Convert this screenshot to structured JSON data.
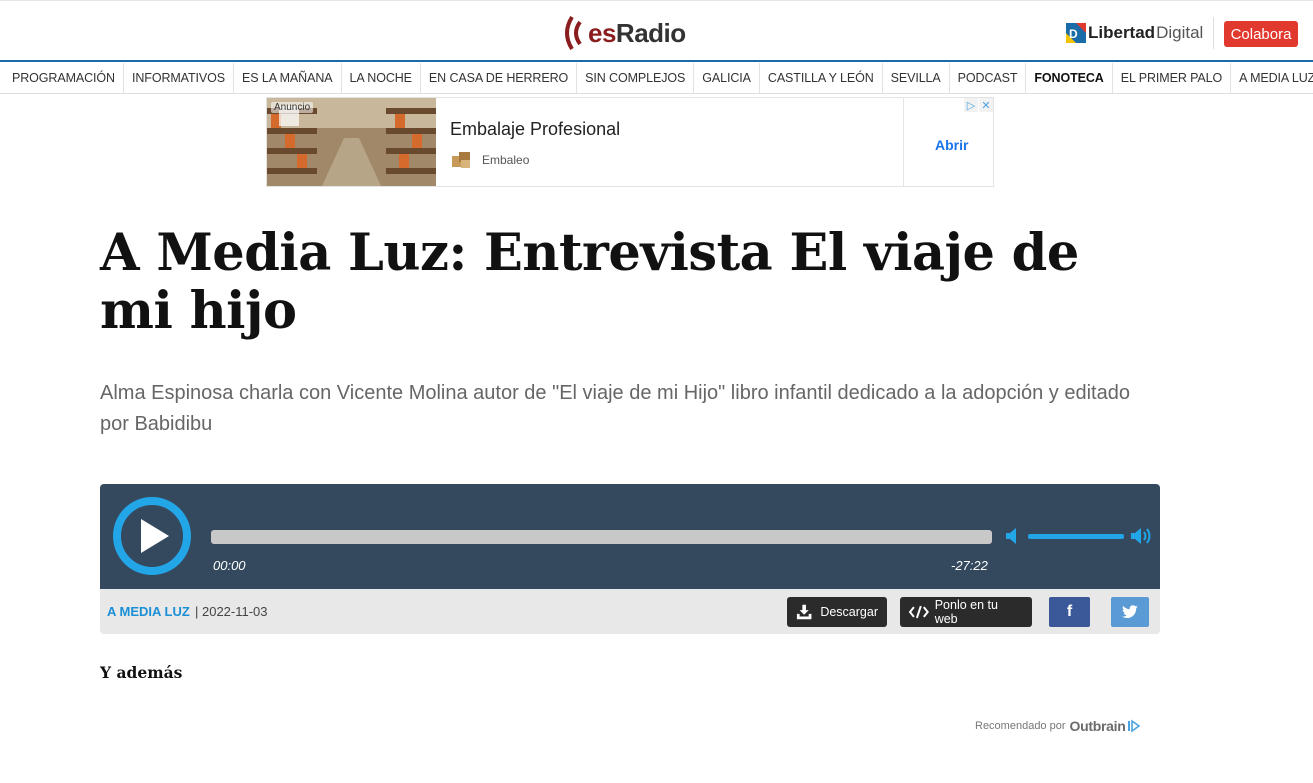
{
  "header": {
    "logo_prefix": "es",
    "logo_suffix": "Radio",
    "partner_bold": "Libertad",
    "partner_light": "Digital",
    "cta_label": "Colabora"
  },
  "nav": {
    "items": [
      "PROGRAMACIÓN",
      "INFORMATIVOS",
      "ES LA MAÑANA",
      "LA NOCHE",
      "EN CASA DE HERRERO",
      "SIN COMPLEJOS",
      "GALICIA",
      "CASTILLA Y LEÓN",
      "SEVILLA",
      "PODCAST",
      "FONOTECA",
      "EL PRIMER PALO",
      "A MEDIA LUZ"
    ],
    "active": "FONOTECA"
  },
  "ad": {
    "label": "Anuncio",
    "title": "Embalaje Profesional",
    "brand": "Embaleo",
    "cta": "Abrir"
  },
  "article": {
    "title": "A Media Luz: Entrevista El viaje de mi hijo",
    "subtitle": "Alma Espinosa charla con Vicente Molina autor de \"El viaje de mi Hijo\" libro infantil dedicado a la adopción y editado por Babidibu"
  },
  "player": {
    "current_time": "00:00",
    "remaining_time": "-27:22",
    "progress": 0,
    "volume": 1.0,
    "program": "A MEDIA LUZ",
    "date_text": "| 2022-11-03",
    "download_label": "Descargar",
    "embed_label": "Ponlo en tu web",
    "facebook_label": "f"
  },
  "related": {
    "heading": "Y además",
    "recommended_text": "Recomendado por",
    "recommended_brand": "Outbrain"
  },
  "colors": {
    "accent_blue": "#22a6e8",
    "player_bg": "#34495e",
    "cta_red": "#e2392f",
    "facebook": "#3b5998",
    "twitter": "#5b9bd5",
    "logo_red": "#8a1d1d"
  }
}
